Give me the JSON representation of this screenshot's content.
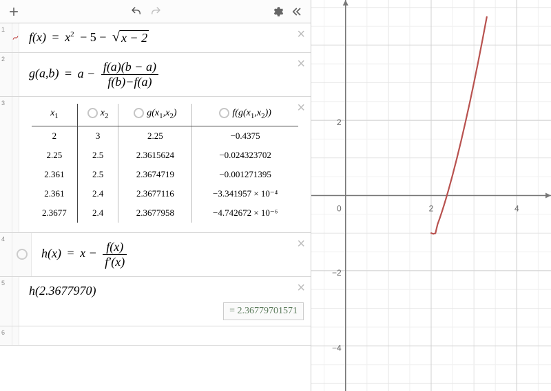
{
  "toolbar": {
    "add": "+",
    "undo": "undo",
    "redo": "redo",
    "settings": "settings",
    "collapse": "«"
  },
  "rows": {
    "r1": {
      "index": "1",
      "lhs": "f(x)",
      "eq": "=",
      "term1": "x",
      "sq": "2",
      "minus": "− 5 −",
      "rad_arg": "x − 2"
    },
    "r2": {
      "index": "2",
      "lhs": "g(a,b)",
      "eq": "=",
      "lead": "a −",
      "num": "f(a)(b − a)",
      "den": "f(b)−f(a)"
    },
    "r3": {
      "index": "3",
      "headers": {
        "c1": "x",
        "c1sub": "1",
        "c2": "x",
        "c2sub": "2",
        "c3a": "g(x",
        "c3b": "1",
        "c3c": ",x",
        "c3d": "2",
        "c3e": ")",
        "c4a": "f(g(x",
        "c4b": "1",
        "c4c": ",x",
        "c4d": "2",
        "c4e": "))"
      },
      "data": [
        {
          "x1": "2",
          "x2": "3",
          "g": "2.25",
          "fg": "−0.4375"
        },
        {
          "x1": "2.25",
          "x2": "2.5",
          "g": "2.3615624",
          "fg": "−0.024323702"
        },
        {
          "x1": "2.361",
          "x2": "2.5",
          "g": "2.3674719",
          "fg": "−0.001271395"
        },
        {
          "x1": "2.361",
          "x2": "2.4",
          "g": "2.3677116",
          "fg": "−3.341957 × 10⁻⁴"
        },
        {
          "x1": "2.3677",
          "x2": "2.4",
          "g": "2.3677958",
          "fg": "−4.742672 × 10⁻⁶"
        }
      ]
    },
    "r4": {
      "index": "4",
      "lhs": "h(x)",
      "eq": "=",
      "lead": "x −",
      "num": "f(x)",
      "den": "f′(x)"
    },
    "r5": {
      "index": "5",
      "call": "h(2.3677970)",
      "result_eq": "=",
      "result": "2.36779701571"
    },
    "r6": {
      "index": "6"
    }
  },
  "graph": {
    "axis": {
      "t0": "0",
      "t2p": "2",
      "t2n": "−2",
      "t4p": "4",
      "t4n": "−4"
    }
  },
  "chart_data": {
    "type": "line",
    "title": "",
    "xlabel": "",
    "ylabel": "",
    "xlim": [
      -0.8,
      4.8
    ],
    "ylim": [
      -5.2,
      5.2
    ],
    "series": [
      {
        "name": "f(x)=x^2-5-sqrt(x-2)",
        "x": [
          2.0,
          2.05,
          2.1,
          2.15,
          2.2,
          2.25,
          2.3,
          2.35,
          2.4,
          2.5,
          2.6,
          2.7,
          2.8,
          2.9,
          3.0,
          3.1,
          3.2,
          3.3
        ],
        "y": [
          -1.0,
          -1.021,
          -1.006,
          -0.765,
          -0.607,
          -0.4375,
          -0.258,
          -0.069,
          0.128,
          0.543,
          0.986,
          1.454,
          1.946,
          2.461,
          3.0,
          3.561,
          4.145,
          4.75
        ]
      }
    ]
  }
}
